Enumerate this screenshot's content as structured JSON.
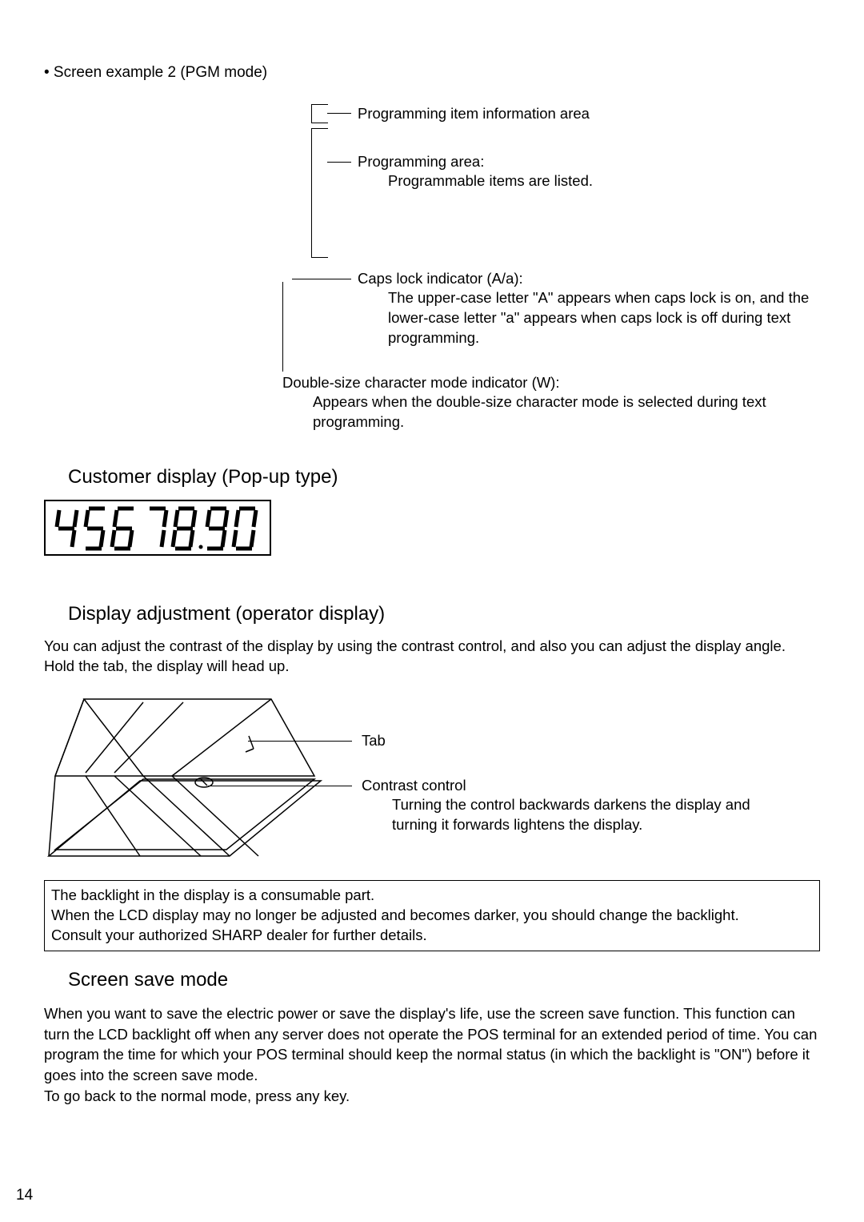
{
  "bullet_head": "• Screen example 2 (PGM mode)",
  "top_diag": {
    "info_area": "Programming item information area",
    "prog_area_label": "Programming area:",
    "prog_area_sub": "Programmable items are listed.",
    "caps_label": "Caps lock indicator (A/a):",
    "caps_body": "The upper-case letter \"A\" appears when caps lock is on, and the lower-case letter \"a\" appears when caps lock is off during text programming.",
    "double_label": "Double-size character mode indicator (W):",
    "double_body": "Appears when the double-size character mode is selected during text programming."
  },
  "customer_display_heading": "Customer display (Pop-up type)",
  "segment_value": "4567890",
  "adjust_heading": "Display adjustment (operator display)",
  "adjust_body": "You can adjust the contrast of the display by using the contrast control, and also you can adjust the display angle.  Hold the tab, the display will head up.",
  "bottom_diag": {
    "tab_label": "Tab",
    "contrast_label": "Contrast control",
    "contrast_body": "Turning the control backwards darkens the display and turning it forwards lightens the display."
  },
  "note_box": {
    "line1": "The backlight in the display is a consumable part.",
    "line2": "When the LCD display may no longer be adjusted and becomes darker, you should change the backlight.",
    "line3": "Consult your authorized SHARP dealer for further details."
  },
  "screen_save_heading": "Screen save mode",
  "screen_save_body": "When you want to save the electric power or save the display's life, use the screen save function. This function can turn the LCD backlight off when any server does not operate the POS terminal for an extended period of time. You can program the time for which your POS terminal should keep the normal status (in which the backlight is \"ON\") before it goes into the screen save mode.",
  "screen_save_return": "To go back to the normal mode, press any key.",
  "page_number": "14"
}
